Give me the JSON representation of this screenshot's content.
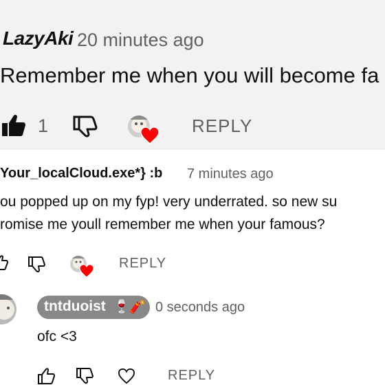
{
  "top_comment": {
    "author": "LazyAki",
    "time": "20 minutes ago",
    "text": "Remember me when you will become fa",
    "likes": "1",
    "reply_label": "REPLY"
  },
  "comment": {
    "author": "Your_localCloud.exe*} :b",
    "time": "7 minutes ago",
    "line1": "ou popped up on my fyp! very underrated. so new su",
    "line2": "romise me youll remember me when your famous?",
    "reply_label": "REPLY"
  },
  "reply": {
    "author": "tntduoist",
    "author_emoji": "🍷🧨",
    "time": "0 seconds ago",
    "text": "ofc <3",
    "reply_label": "REPLY"
  },
  "colors": {
    "heart": "#ff0000",
    "chip": "#888888",
    "top_background": "#f2f2f2"
  }
}
